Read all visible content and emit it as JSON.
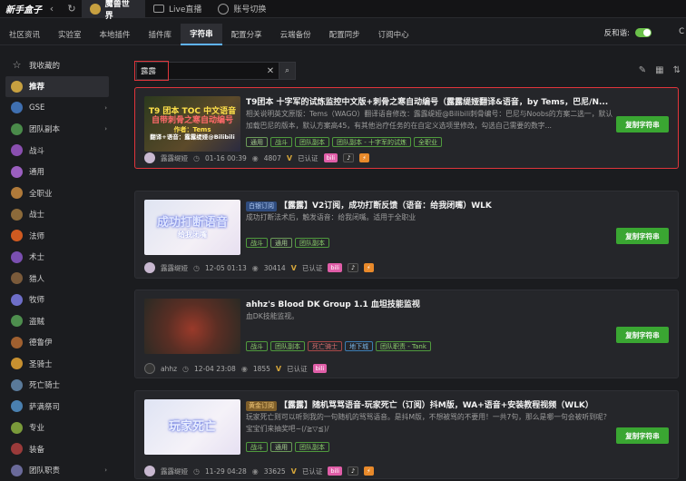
{
  "topbar": {
    "logo": "新手盒子",
    "tabs": [
      {
        "label": "魔兽世界"
      },
      {
        "label": "Live直播"
      },
      {
        "label": "账号切换"
      }
    ]
  },
  "subnav": {
    "items": [
      "社区资讯",
      "实验室",
      "本地插件",
      "插件库",
      "字符串",
      "配置分享",
      "云端备份",
      "配置同步",
      "订阅中心"
    ],
    "reverse_label": "反和谐:",
    "edge_text": "C"
  },
  "sidebar": {
    "items": [
      {
        "label": "我收藏的",
        "icon": "star-icon",
        "color": "#888888"
      },
      {
        "label": "推荐",
        "icon": "wow-icon",
        "color": "#c7a040"
      },
      {
        "label": "GSE",
        "icon": "gse-icon",
        "color": "#3f6fb0",
        "chevron": true
      },
      {
        "label": "团队副本",
        "icon": "raid-icon",
        "color": "#4a8a4a",
        "chevron": true
      },
      {
        "label": "战斗",
        "icon": "combat-icon",
        "color": "#8a4fb0"
      },
      {
        "label": "通用",
        "icon": "general-icon",
        "color": "#9b5fc0"
      },
      {
        "label": "全职业",
        "icon": "allclass-icon",
        "color": "#b07a3a"
      },
      {
        "label": "战士",
        "icon": "warrior-icon",
        "color": "#8c6a3a"
      },
      {
        "label": "法师",
        "icon": "mage-icon",
        "color": "#d05a20"
      },
      {
        "label": "术士",
        "icon": "warlock-icon",
        "color": "#7a4fb0"
      },
      {
        "label": "猎人",
        "icon": "hunter-icon",
        "color": "#7a5a3a"
      },
      {
        "label": "牧师",
        "icon": "priest-icon",
        "color": "#6e6ec8"
      },
      {
        "label": "盗贼",
        "icon": "rogue-icon",
        "color": "#4e8e4e"
      },
      {
        "label": "德鲁伊",
        "icon": "druid-icon",
        "color": "#a06030"
      },
      {
        "label": "圣骑士",
        "icon": "paladin-icon",
        "color": "#c79030"
      },
      {
        "label": "死亡骑士",
        "icon": "deathknight-icon",
        "color": "#5a7a9a"
      },
      {
        "label": "萨满祭司",
        "icon": "shaman-icon",
        "color": "#4a80b0"
      },
      {
        "label": "专业",
        "icon": "profession-icon",
        "color": "#7a9a3a"
      },
      {
        "label": "装备",
        "icon": "gear-icon",
        "color": "#9a3a3a"
      },
      {
        "label": "团队职责",
        "icon": "role-icon",
        "color": "#6a6a9a",
        "chevron": true
      }
    ]
  },
  "search": {
    "value": "露露",
    "clear": "✕",
    "search_icon": "search-icon"
  },
  "copy_label": "复制字符串",
  "cards": [
    {
      "prefix": "",
      "prefix_color": "",
      "title": "T9团本 十字军的试炼监控中文版+刺骨之寒自动编号（露露缇娅翻译&语音，by Tems，巴尼/N...",
      "desc": "相关说明英文原版：Tems（WAGO）翻译语音修改：露露缇娅@Bilibili刺骨编号：巴尼与Noobs的方案二选一，默认加载巴尼的版本，默认方案高45，有其他治疗任务的在自定义选项里修改，勾选自己需要的数字...",
      "tags": [
        {
          "t": "通用",
          "c": "tgr"
        },
        {
          "t": "战斗",
          "c": "tg"
        },
        {
          "t": "团队副本",
          "c": "tg"
        },
        {
          "t": "团队副本 - 十字军的试炼",
          "c": "tg"
        },
        {
          "t": "全职业",
          "c": "tg"
        }
      ],
      "author": "露露缇娅",
      "date": "01-16 00:39",
      "views": "4807",
      "verified": "已认证",
      "thumb": {
        "bg": "linear-gradient(135deg,#2c3a1e,#5c4a2a 60%,#2a2a40)",
        "l1": "T9 团本 TOC 中文语音",
        "l2": "自带刺骨之寒自动编号",
        "l3": "作者：Tems",
        "l4": "翻译+语音：露露缇娅@Bilibili",
        "c1": "#ffe14a",
        "c2": "#ff6a6a"
      }
    },
    {
      "prefix": "白银订阅",
      "prefix_color": "blue",
      "title": "【露露】V2订阅，成功打断反馈（语音：给我闭嘴）WLK",
      "desc": "成功打断法术后，触发语音：给我闭嘴。适用于全职业",
      "tags": [
        {
          "t": "战斗",
          "c": "tg"
        },
        {
          "t": "通用",
          "c": "tgr"
        },
        {
          "t": "团队副本",
          "c": "tg"
        }
      ],
      "author": "露露缇娅",
      "date": "12-05 01:13",
      "views": "30414",
      "verified": "已认证",
      "thumb": {
        "bg": "linear-gradient(135deg,#dfe4f2,#f4f0f6 60%,#e7dff0)",
        "l1": "成功打断语音",
        "l2": "给我闭嘴",
        "l3": "",
        "l4": "",
        "c1": "#e0e6ff",
        "c2": "#ffffff"
      }
    },
    {
      "prefix": "",
      "prefix_color": "",
      "title": "ahhz's Blood DK Group 1.1 血坦技能监视",
      "desc": "血DK技能监视。",
      "tags": [
        {
          "t": "战斗",
          "c": "tg"
        },
        {
          "t": "团队副本",
          "c": "tg"
        },
        {
          "t": "死亡骑士",
          "c": "tr"
        },
        {
          "t": "地下城",
          "c": "tb"
        },
        {
          "t": "团队职责 - Tank",
          "c": "tg"
        }
      ],
      "author": "ahhz",
      "date": "12-04 23:08",
      "views": "1855",
      "verified": "已认证",
      "thumb": {
        "bg": "radial-gradient(circle at 50% 55%,#9a3a2a,#5a2e24 45%,#2a2a24 100%)",
        "l1": "",
        "l2": "",
        "l3": "",
        "l4": "",
        "c1": "#fff",
        "c2": "#fff"
      }
    },
    {
      "prefix": "黄金订阅",
      "prefix_color": "gold",
      "title": "【露露】随机骂骂语音-玩家死亡（订阅）抖M版，WA+语音+安装教程视频（WLK）",
      "desc": "玩家死亡则可以听到我的一句随机的骂骂语音。是抖M版，不想被骂的不要用！一共7句，那么是哪一句会被听到呢？宝宝们来抽奖吧~(/≧▽≦)/",
      "tags": [
        {
          "t": "战斗",
          "c": "tg"
        },
        {
          "t": "通用",
          "c": "tgr"
        },
        {
          "t": "团队副本",
          "c": "tg"
        }
      ],
      "author": "露露缇娅",
      "date": "11-29 04:28",
      "views": "33625",
      "verified": "已认证",
      "thumb": {
        "bg": "linear-gradient(135deg,#dfe4f4,#f5f2f8 60%,#e6e0f2)",
        "l1": "玩家死亡",
        "l2": "",
        "l3": "",
        "l4": "",
        "c1": "#e9eeff",
        "c2": "#fff"
      }
    }
  ]
}
